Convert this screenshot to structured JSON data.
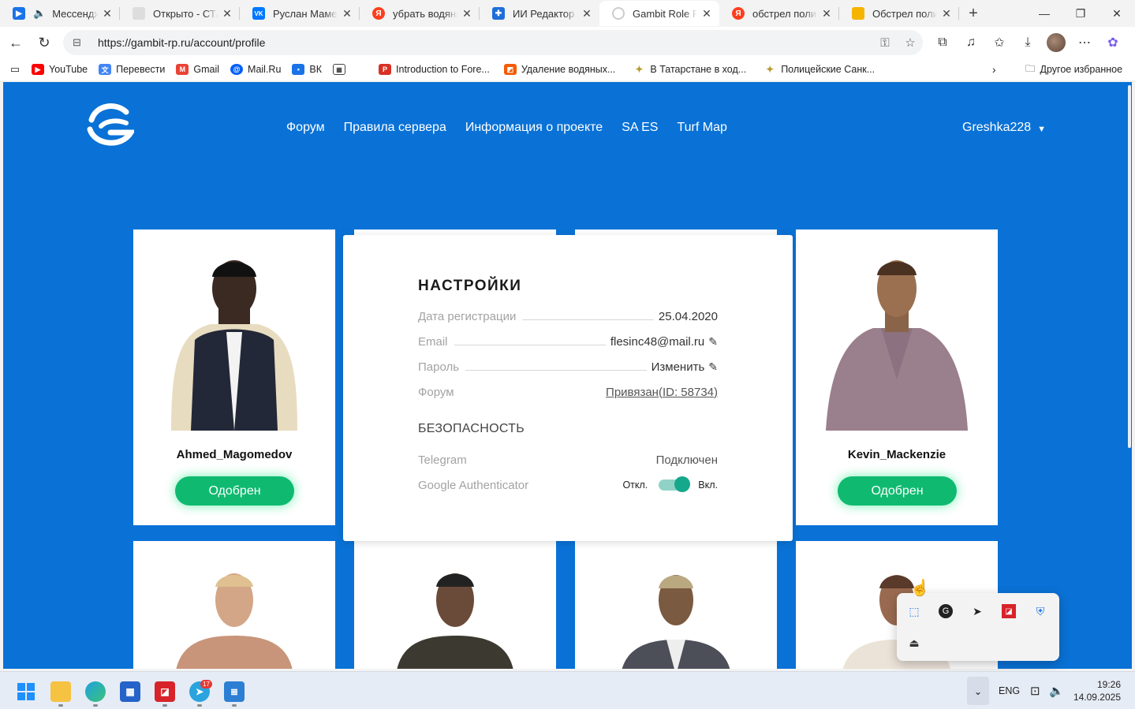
{
  "browser": {
    "tabs": [
      {
        "title": "Мессендже",
        "fav_color": "#1a73e8",
        "fav_text": "▶"
      },
      {
        "title": "Открыто - СТАР",
        "fav_color": "#cccccc",
        "fav_text": ""
      },
      {
        "title": "Руслан Мамедо",
        "fav_color": "#0077ff",
        "fav_text": "VK"
      },
      {
        "title": "убрать водяные",
        "fav_color": "#fc3f1d",
        "fav_text": "Я"
      },
      {
        "title": "ИИ Редактор Из",
        "fav_color": "#1e6fd9",
        "fav_text": "✚"
      },
      {
        "title": "Gambit Role Play",
        "fav_color": "#ffffff",
        "fav_text": ""
      },
      {
        "title": "обстрел полице",
        "fav_color": "#fc3f1d",
        "fav_text": "Я"
      },
      {
        "title": "Обстрел полице",
        "fav_color": "#f5b400",
        "fav_text": ""
      }
    ],
    "url": "https://gambit-rp.ru/account/profile",
    "bookmarks": [
      {
        "label": "YouTube",
        "color": "#ff0000",
        "icon": "▶"
      },
      {
        "label": "Перевести",
        "color": "#4285f4",
        "icon": "文"
      },
      {
        "label": "Gmail",
        "color": "#ea4335",
        "icon": "M"
      },
      {
        "label": "Mail.Ru",
        "color": "#005ff9",
        "icon": "@"
      },
      {
        "label": "ВК",
        "color": "#1a73e8",
        "icon": "▪"
      },
      {
        "label": "",
        "color": "#555555",
        "icon": "▦"
      },
      {
        "label": "Introduction to Fore...",
        "color": "#d93025",
        "icon": "P"
      },
      {
        "label": "Удаление водяных...",
        "color": "#f25c05",
        "icon": "◩"
      },
      {
        "label": "В Татарстане в ход...",
        "color": "#b59a2b",
        "icon": "✦"
      },
      {
        "label": "Полицейские Санк...",
        "color": "#b59a2b",
        "icon": "✦"
      }
    ],
    "other_bookmarks": "Другое избранное"
  },
  "site": {
    "nav": [
      "Форум",
      "Правила сервера",
      "Информация о проекте",
      "SA ES",
      "Turf Map"
    ],
    "username": "Greshka228",
    "cards": [
      {
        "name": "Ahmed_Magomedov",
        "status": "Одобрен"
      },
      {
        "name": "Kevin_Mackenzie",
        "status": "Одобрен"
      }
    ],
    "settings": {
      "title": "НАСТРОЙКИ",
      "reg_label": "Дата регистрации",
      "reg_value": "25.04.2020",
      "email_label": "Email",
      "email_value": "flesinc48@mail.ru",
      "password_label": "Пароль",
      "password_value": "Изменить",
      "forum_label": "Форум",
      "forum_value": "Привязан(ID: 58734)",
      "security_title": "БЕЗОПАСНОСТЬ",
      "telegram_label": "Telegram",
      "telegram_value": "Подключен",
      "ga_label": "Google Authenticator",
      "ga_off": "Откл.",
      "ga_on": "Вкл.",
      "ga_enabled": true
    }
  },
  "taskbar": {
    "lang": "ENG",
    "time": "19:26",
    "date": "14.09.2025",
    "telegram_badge": "17"
  }
}
